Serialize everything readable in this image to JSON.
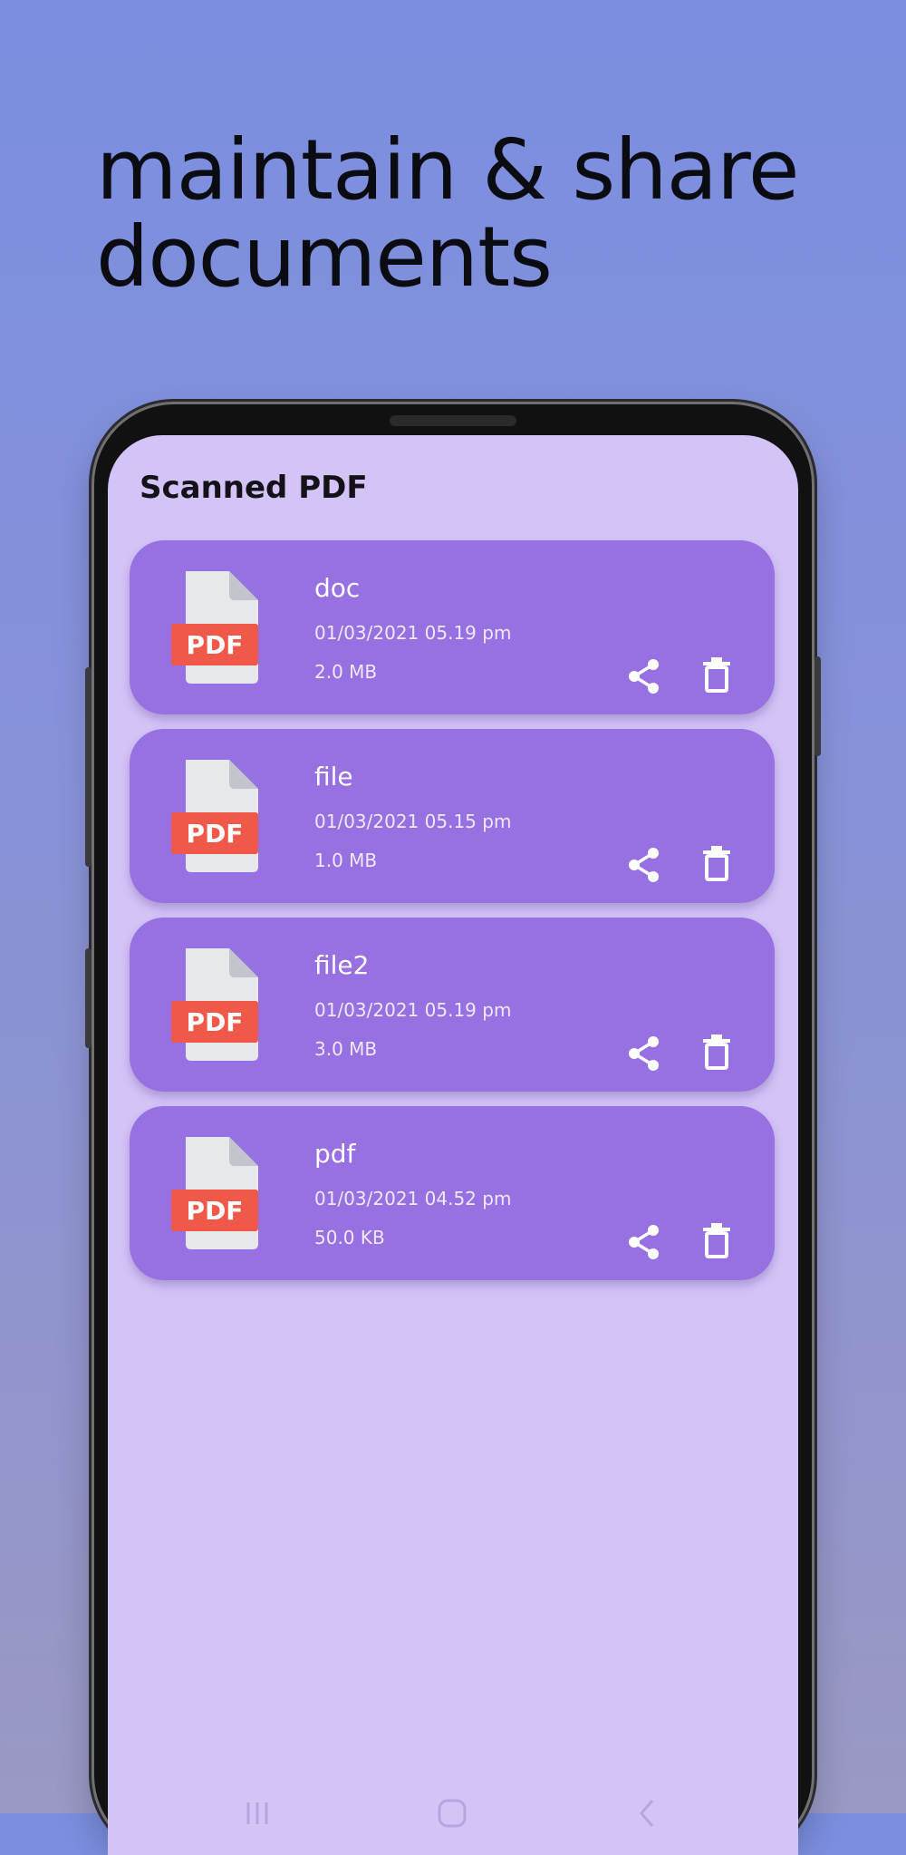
{
  "promo": {
    "headline": "maintain & share documents"
  },
  "app": {
    "title": "Scanned PDF"
  },
  "files": [
    {
      "name": "doc",
      "date": "01/03/2021 05.19 pm",
      "size": "2.0 MB",
      "badge": "PDF"
    },
    {
      "name": "file",
      "date": "01/03/2021 05.15 pm",
      "size": "1.0 MB",
      "badge": "PDF"
    },
    {
      "name": "file2",
      "date": "01/03/2021 05.19 pm",
      "size": "3.0 MB",
      "badge": "PDF"
    },
    {
      "name": "pdf",
      "date": "01/03/2021 04.52 pm",
      "size": "50.0 KB",
      "badge": "PDF"
    }
  ],
  "icons": {
    "file": "pdf-file-icon",
    "share": "share-icon",
    "delete": "trash-icon",
    "nav": [
      "recent-apps-icon",
      "home-icon",
      "back-icon"
    ]
  },
  "colors": {
    "background": "#7a8edf",
    "screen": "#d4c3f7",
    "card": "#9770e1",
    "pdf_badge": "#f0584a",
    "page": "#e6e8ec"
  }
}
